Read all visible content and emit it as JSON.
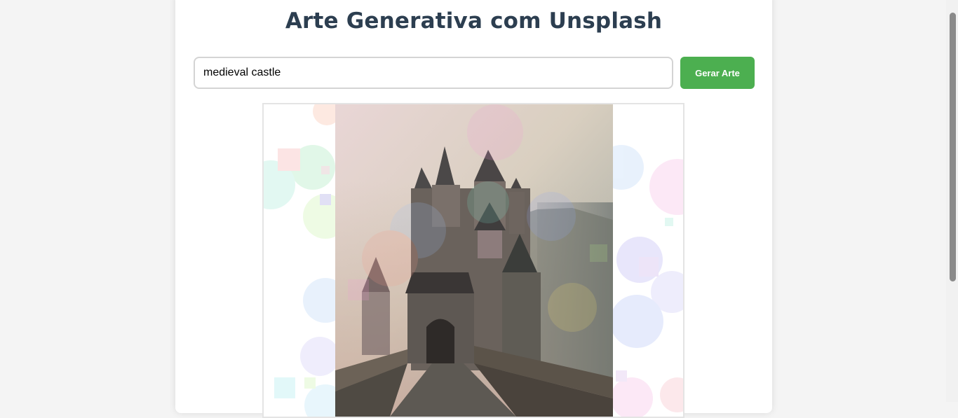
{
  "page": {
    "title": "Arte Generativa com Unsplash"
  },
  "search": {
    "value": "medieval castle",
    "placeholder": ""
  },
  "toolbar": {
    "generate_label": "Gerar Arte"
  },
  "colors": {
    "title": "#2c3e50",
    "button": "#4caf50",
    "background": "#f4f4f4",
    "card": "#ffffff"
  },
  "canvas": {
    "image_subject": "medieval castle",
    "overlay": "translucent pastel circles and squares"
  }
}
